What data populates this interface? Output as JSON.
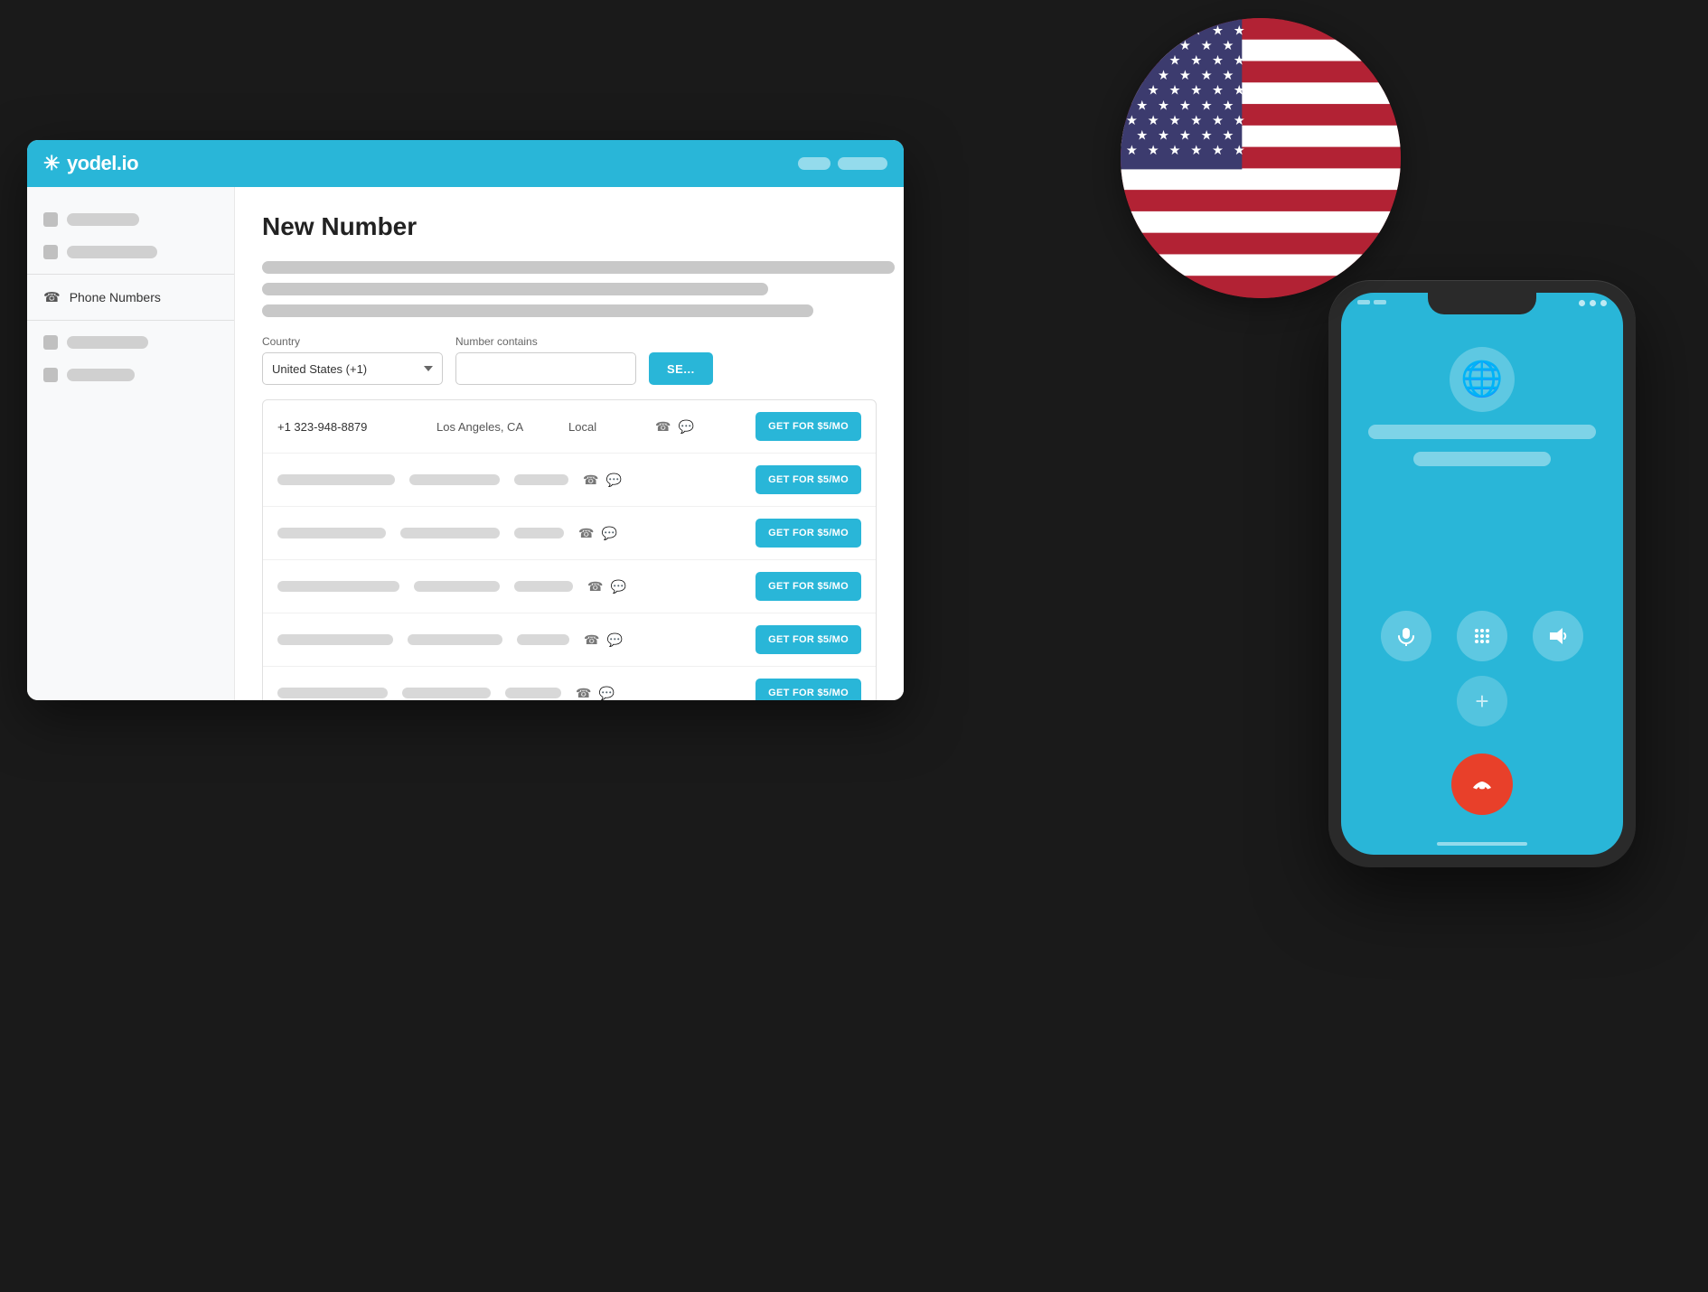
{
  "app": {
    "logo": "yodel.io",
    "logo_icon": "✳",
    "title": "New Number"
  },
  "browser": {
    "tab1": "──",
    "tab2": "────────"
  },
  "sidebar": {
    "items": [
      {
        "id": "item1",
        "label": "",
        "has_icon": true
      },
      {
        "id": "item2",
        "label": "",
        "has_icon": true
      },
      {
        "id": "phone-numbers",
        "label": "Phone Numbers",
        "has_icon": true
      },
      {
        "id": "item4",
        "label": "",
        "has_icon": true
      },
      {
        "id": "item5",
        "label": "",
        "has_icon": true
      }
    ]
  },
  "filters": {
    "country_label": "Country",
    "country_value": "United States (+1)",
    "number_contains_label": "Number contains",
    "number_contains_placeholder": "",
    "search_button": "SE..."
  },
  "table": {
    "rows": [
      {
        "number": "+1 323-948-8879",
        "location": "Los Angeles, CA",
        "type": "Local",
        "capabilities": "📞 💬",
        "button": "GET FOR $5/MO",
        "is_real": true
      },
      {
        "is_real": false,
        "button": "GET FOR $5/MO"
      },
      {
        "is_real": false,
        "button": "GET FOR $5/MO"
      },
      {
        "is_real": false,
        "button": "GET FOR $5/MO"
      },
      {
        "is_real": false,
        "button": "GET FOR $5/MO"
      },
      {
        "is_real": false,
        "button": "GET FOR $5/MO"
      }
    ]
  },
  "phone": {
    "globe_icon": "🌐",
    "end_call_icon": "📵",
    "controls": {
      "mic": "🎤",
      "keypad": "⌨",
      "speaker": "🔊",
      "add": "+"
    }
  },
  "flag": {
    "country": "United States"
  }
}
